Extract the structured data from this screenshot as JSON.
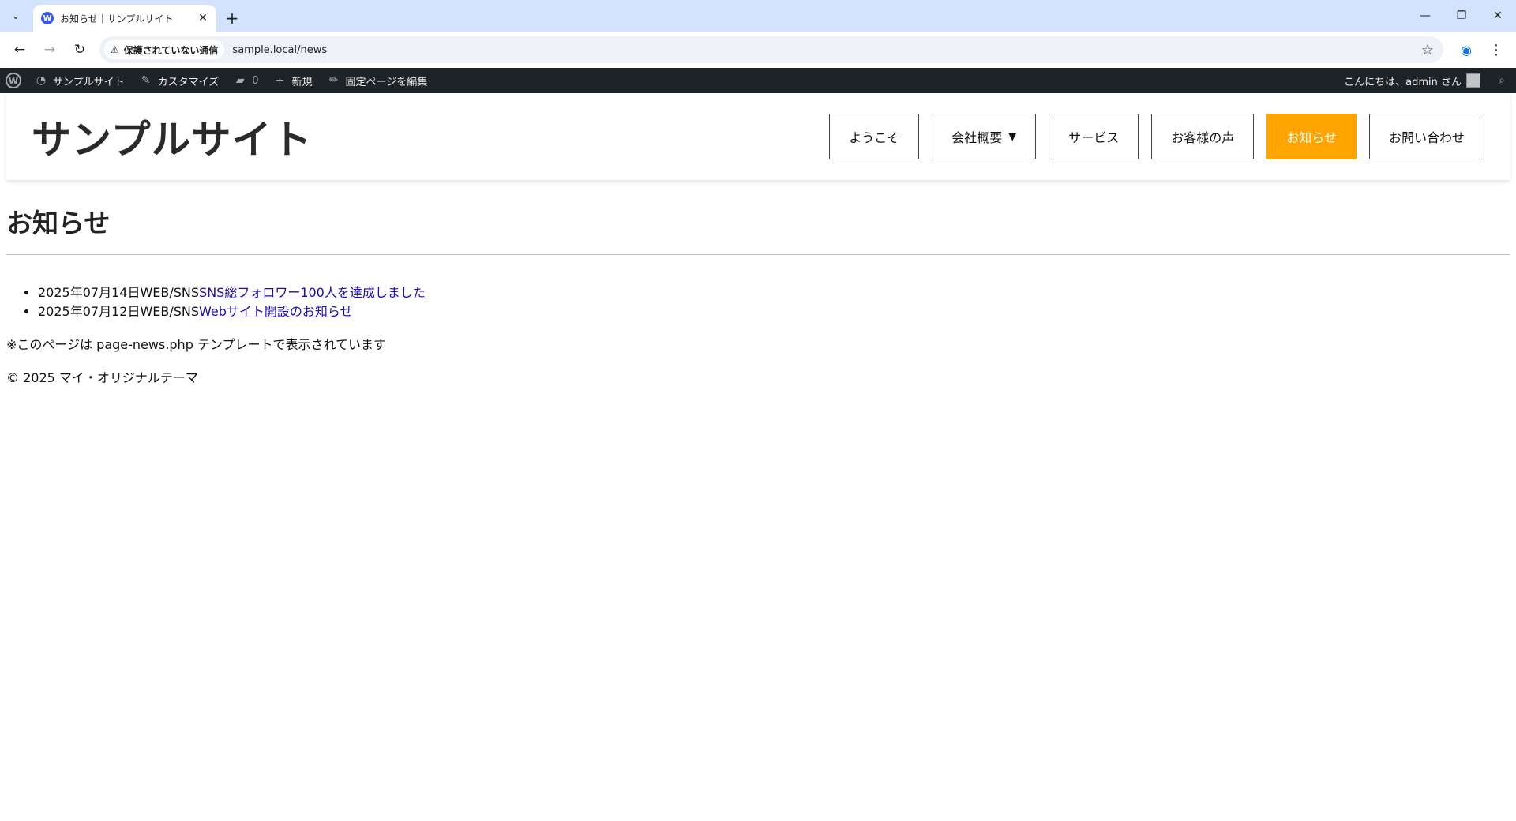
{
  "browser": {
    "tab_title": "お知らせ｜サンプルサイト",
    "favicon_letter": "W",
    "security_label": "保護されていない通信",
    "url": "sample.local/news"
  },
  "adminbar": {
    "site_name": "サンプルサイト",
    "customize": "カスタマイズ",
    "comments_count": "0",
    "new": "新規",
    "edit_page": "固定ページを編集",
    "greeting": "こんにちは、admin さん"
  },
  "site": {
    "title": "サンプルサイト",
    "nav": [
      {
        "label": "ようこそ"
      },
      {
        "label": "会社概要"
      },
      {
        "label": "サービス"
      },
      {
        "label": "お客様の声"
      },
      {
        "label": "お知らせ"
      },
      {
        "label": "お問い合わせ"
      }
    ],
    "active_color": "#ffa400"
  },
  "page": {
    "heading": "お知らせ",
    "news": [
      {
        "date": "2025年07月14日",
        "category": "WEB/SNS",
        "title": "SNS総フォロワー100人を達成しました"
      },
      {
        "date": "2025年07月12日",
        "category": "WEB/SNS",
        "title": "Webサイト開設のお知らせ"
      }
    ],
    "note": "※このページは page-news.php テンプレートで表示されています",
    "footer": "© 2025 マイ・オリジナルテーマ"
  }
}
